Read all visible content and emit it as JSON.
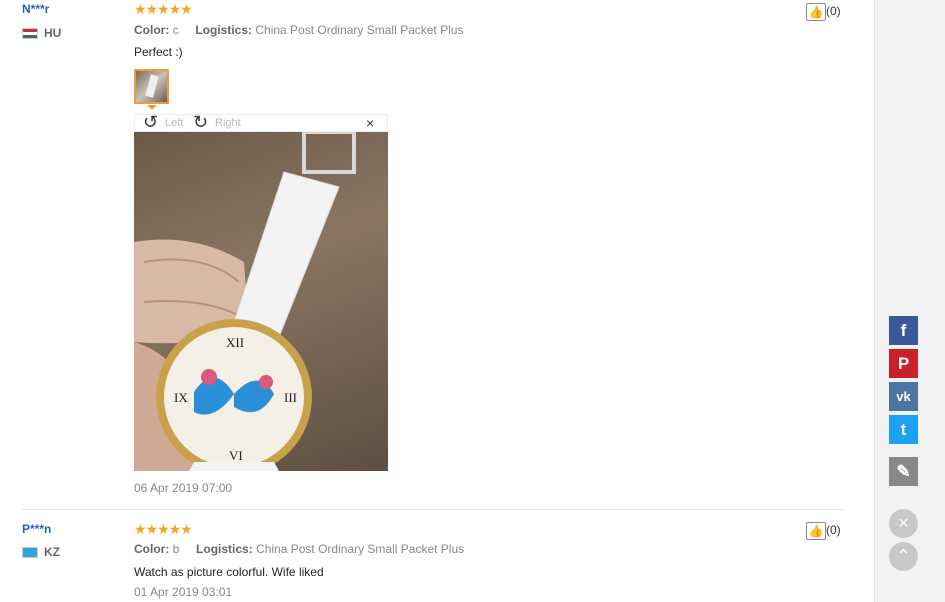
{
  "reviews": [
    {
      "user": "N***r",
      "country": "HU",
      "color_label": "Color:",
      "color_value": "c",
      "logistics_label": "Logistics:",
      "logistics_value": "China Post Ordinary Small Packet Plus",
      "stars": "★★★★★",
      "rating": 5,
      "text": "Perfect :)",
      "date": "06 Apr 2019 07:00",
      "helpful_count": "(0)"
    },
    {
      "user": "P***n",
      "country": "KZ",
      "color_label": "Color:",
      "color_value": "b",
      "logistics_label": "Logistics:",
      "logistics_value": "China Post Ordinary Small Packet Plus",
      "stars": "★★★★★",
      "rating": 5,
      "text": "Watch as picture colorful. Wife liked",
      "date": "01 Apr 2019 03:01",
      "helpful_count": "(0)"
    }
  ],
  "viewer": {
    "rotate_left": "Left",
    "rotate_right": "Right",
    "close": "×"
  },
  "sidebar": {
    "facebook": "f",
    "pinterest": "P",
    "vk": "vk",
    "twitter": "t",
    "edit": "✎",
    "close": "×",
    "scroll_top": "⌃"
  },
  "colors": {
    "username": "#2a62b8",
    "star": "#f5a623",
    "facebook": "#3b5998",
    "pinterest": "#cb2027",
    "vk": "#4c75a3",
    "twitter": "#1da1f2",
    "edit": "#888888"
  }
}
